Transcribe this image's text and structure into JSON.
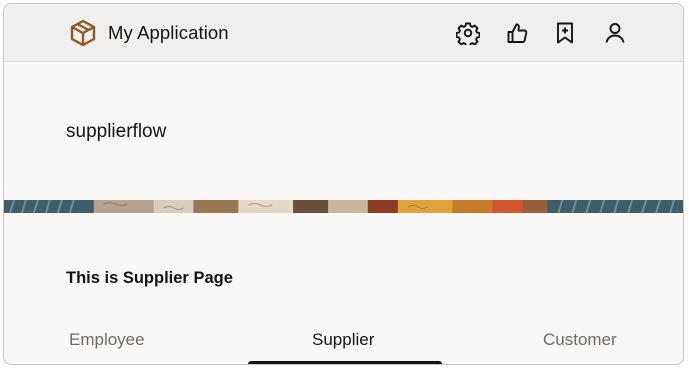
{
  "header": {
    "app_title": "My Application",
    "logo_icon": "cube-icon",
    "toolbar": [
      {
        "icon": "gear-icon"
      },
      {
        "icon": "thumbs-up-icon"
      },
      {
        "icon": "bookmark-add-icon"
      },
      {
        "icon": "user-icon"
      }
    ]
  },
  "page": {
    "heading": "supplierflow",
    "section_text": "This is Supplier Page"
  },
  "tabs": [
    {
      "label": "Employee",
      "selected": false
    },
    {
      "label": "Supplier",
      "selected": true
    },
    {
      "label": "Customer",
      "selected": false
    }
  ],
  "colors": {
    "accent": "#8a5a1e",
    "header_bg": "#f1efed",
    "page_bg": "#faf8f6",
    "text": "#161513"
  }
}
